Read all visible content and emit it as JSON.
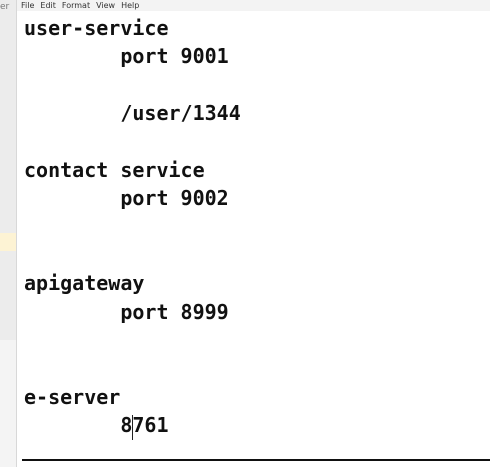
{
  "left_window": {
    "fragment_text": "er"
  },
  "menu": {
    "items": [
      "File",
      "Edit",
      "Format",
      "View",
      "Help"
    ]
  },
  "editor": {
    "lines": [
      "user-service",
      "        port 9001",
      "        /user/1344",
      "contact service",
      "        port 9002",
      "apigateway",
      "        port 8999",
      "e-server",
      "        8761"
    ]
  }
}
